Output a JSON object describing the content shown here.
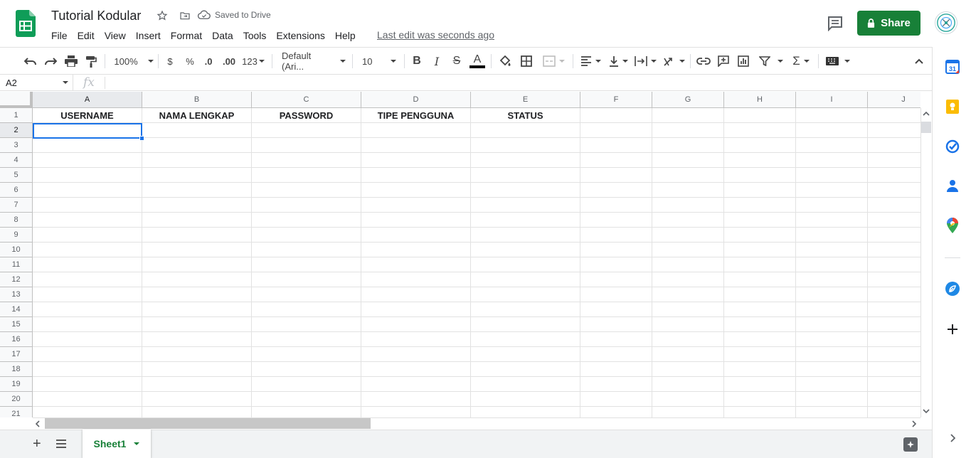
{
  "header": {
    "doc_title": "Tutorial Kodular",
    "saved_status": "Saved to Drive",
    "last_edit": "Last edit was seconds ago",
    "share_label": "Share",
    "menu": [
      "File",
      "Edit",
      "View",
      "Insert",
      "Format",
      "Data",
      "Tools",
      "Extensions",
      "Help"
    ]
  },
  "toolbar": {
    "zoom": "100%",
    "currency": "$",
    "percent": "%",
    "dec_decrease": ".0",
    "dec_increase": ".00",
    "more_formats": "123",
    "font": "Default (Ari...",
    "font_size": "10"
  },
  "formula_bar": {
    "name_box": "A2",
    "fx": "fx"
  },
  "grid": {
    "columns": [
      "A",
      "B",
      "C",
      "D",
      "E",
      "F",
      "G",
      "H",
      "I",
      "J"
    ],
    "rows": [
      "1",
      "2",
      "3",
      "4",
      "5",
      "6",
      "7",
      "8",
      "9",
      "10",
      "11",
      "12",
      "13",
      "14",
      "15",
      "16",
      "17",
      "18",
      "19",
      "20",
      "21"
    ],
    "selected_column": "A",
    "selected_row": "2",
    "row1": [
      "USERNAME",
      "NAMA LENGKAP",
      "PASSWORD",
      "TIPE PENGGUNA",
      "STATUS"
    ]
  },
  "bottom": {
    "sheet_name": "Sheet1"
  },
  "colors": {
    "brand_green": "#188038",
    "selection_blue": "#1a73e8"
  }
}
